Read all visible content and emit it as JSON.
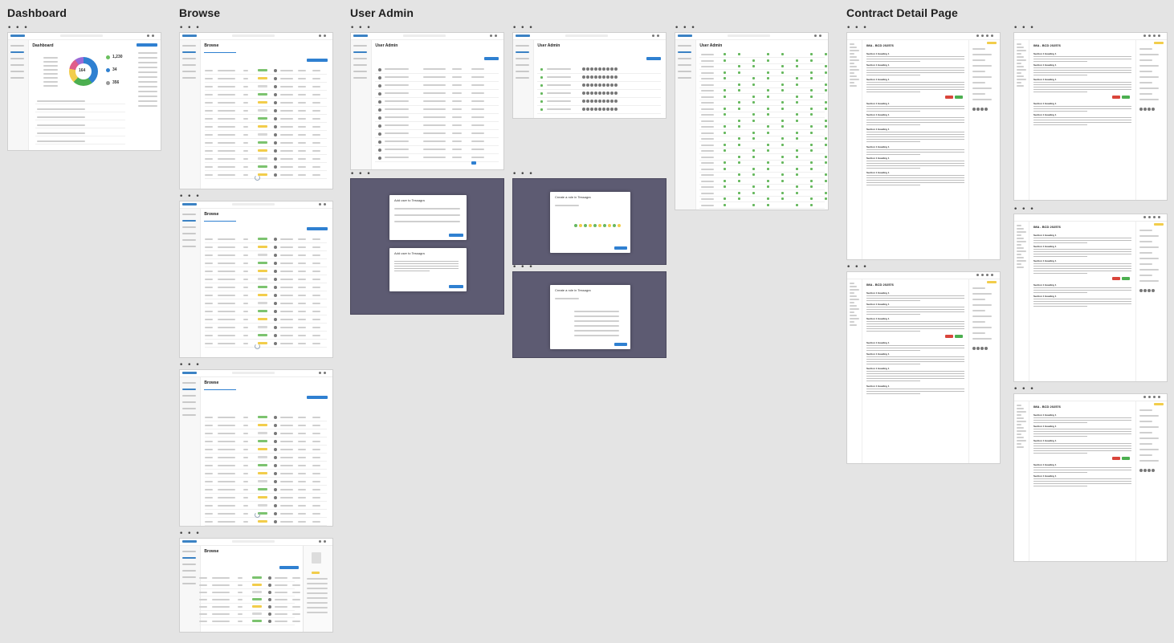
{
  "sections": {
    "dashboard": "Dashboard",
    "browse": "Browse",
    "user_admin": "User Admin",
    "contract_detail": "Contract Detail Page"
  },
  "frame_dots": "• • •",
  "dashboard": {
    "page_title": "Dashboard",
    "donut_value": "164",
    "stats": [
      "1,230",
      "34",
      "356"
    ]
  },
  "browse": {
    "page_title": "Browse"
  },
  "user_admin": {
    "page_title": "User Admin",
    "modal_add_user": "Add user to Tessagra",
    "modal_create_role": "Create a role in Tessagra"
  },
  "contract": {
    "doc_title": "IMA - BCD 202576",
    "section_heading": "Section 1 Heading 1"
  },
  "colors": {
    "accent": "#2f80d1",
    "success": "#4caf50",
    "warning": "#f2cd4b",
    "danger": "#d9453b",
    "overlay": "#5d5b72"
  }
}
